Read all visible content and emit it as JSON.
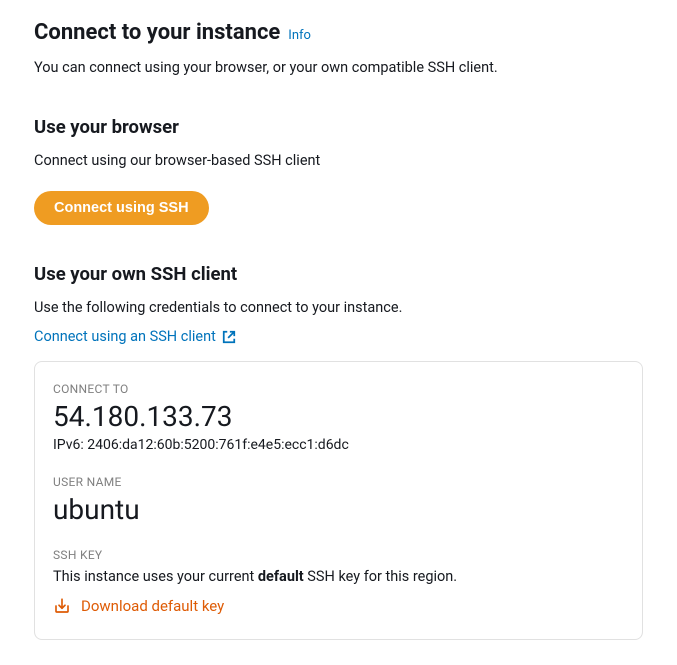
{
  "header": {
    "title": "Connect to your instance",
    "info_label": "Info",
    "description": "You can connect using your browser, or your own compatible SSH client."
  },
  "browser_section": {
    "title": "Use your browser",
    "description": "Connect using our browser-based SSH client",
    "button_label": "Connect using SSH"
  },
  "ssh_section": {
    "title": "Use your own SSH client",
    "description": "Use the following credentials to connect to your instance.",
    "link_label": "Connect using an SSH client"
  },
  "credentials": {
    "connect_to_label": "CONNECT TO",
    "ip": "54.180.133.73",
    "ipv6_prefix": "IPv6: ",
    "ipv6": "2406:da12:60b:5200:761f:e4e5:ecc1:d6dc",
    "username_label": "USER NAME",
    "username": "ubuntu",
    "sshkey_label": "SSH KEY",
    "sshkey_text_prefix": "This instance uses your current ",
    "sshkey_text_bold": "default",
    "sshkey_text_suffix": " SSH key for this region.",
    "download_label": "Download default key"
  }
}
